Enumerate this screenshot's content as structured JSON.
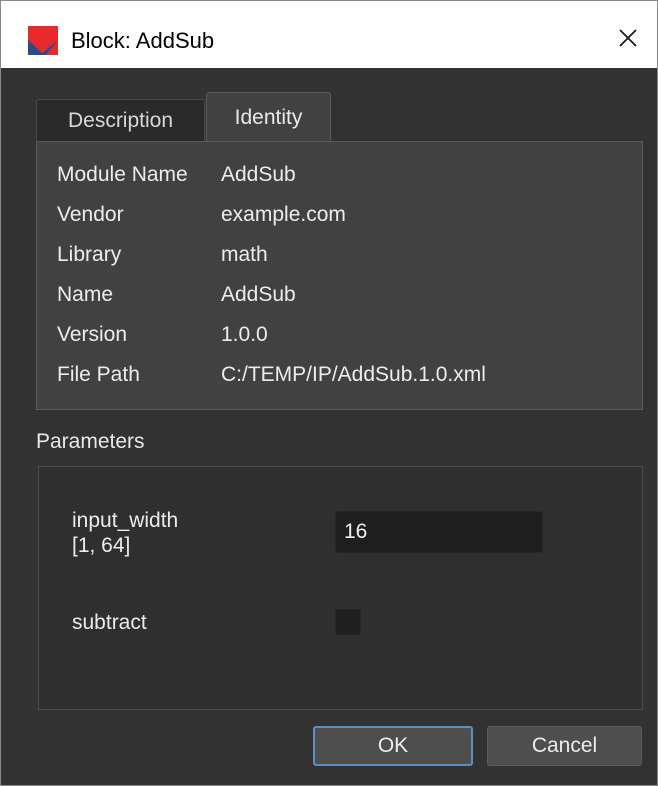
{
  "window": {
    "title": "Block: AddSub",
    "icon": "app-logo-icon",
    "close_icon": "close-icon"
  },
  "tabs": [
    {
      "label": "Description",
      "active": false
    },
    {
      "label": "Identity",
      "active": true
    }
  ],
  "identity": {
    "rows": [
      {
        "label": "Module Name",
        "value": "AddSub"
      },
      {
        "label": "Vendor",
        "value": "example.com"
      },
      {
        "label": "Library",
        "value": "math"
      },
      {
        "label": "Name",
        "value": "AddSub"
      },
      {
        "label": "Version",
        "value": "1.0.0"
      },
      {
        "label": "File Path",
        "value": "C:/TEMP/IP/AddSub.1.0.xml"
      }
    ]
  },
  "parameters": {
    "title": "Parameters",
    "input_width": {
      "label": "input_width\n[1, 64]",
      "value": "16"
    },
    "subtract": {
      "label": "subtract",
      "checked": false
    }
  },
  "buttons": {
    "ok": "OK",
    "cancel": "Cancel"
  },
  "colors": {
    "window_bg": "#323232",
    "panel_bg": "#414141",
    "focus_border": "#5a8fc0",
    "logo_red": "#e8292b",
    "logo_blue": "#2a4a8c"
  }
}
